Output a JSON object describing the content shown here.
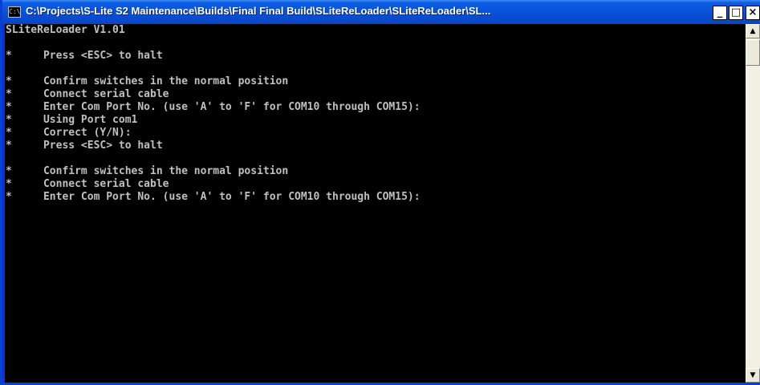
{
  "window": {
    "title": "C:\\Projects\\S-Lite S2 Maintenance\\Builds\\Final Final Build\\SLiteReLoader\\SLiteReLoader\\SL...",
    "icon": "console-icon",
    "icon_glyph": "C:\\",
    "minimize_glyph": "_",
    "maximize_glyph": "□",
    "close_glyph": "×"
  },
  "console": {
    "lines": [
      "SLiteReLoader V1.01",
      "",
      "*     Press <ESC> to halt",
      "",
      "*     Confirm switches in the normal position",
      "*     Connect serial cable",
      "*     Enter Com Port No. (use 'A' to 'F' for COM10 through COM15):",
      "*     Using Port com1",
      "*     Correct (Y/N):",
      "*     Press <ESC> to halt",
      "",
      "*     Confirm switches in the normal position",
      "*     Connect serial cable",
      "*     Enter Com Port No. (use 'A' to 'F' for COM10 through COM15):"
    ]
  },
  "scrollbar": {
    "up_arrow": "▲",
    "down_arrow": "▼"
  },
  "colors": {
    "title_bar": "#0a50d8",
    "console_bg": "#000000",
    "console_text": "#c0c0c0"
  }
}
